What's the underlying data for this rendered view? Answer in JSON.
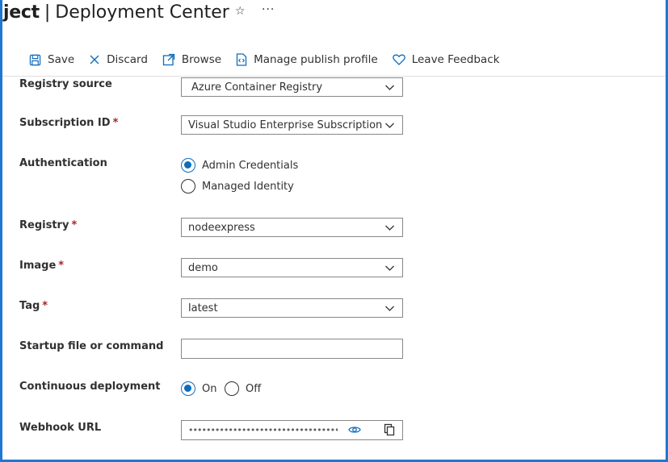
{
  "header": {
    "title_fragment": "ject",
    "separator": "|",
    "title": "Deployment Center",
    "favorite_icon": "star-icon",
    "more_icon": "ellipsis-icon",
    "more_glyph": "···",
    "star_glyph": "☆"
  },
  "toolbar": {
    "save": "Save",
    "discard": "Discard",
    "browse": "Browse",
    "manage_publish_profile": "Manage publish profile",
    "leave_feedback": "Leave Feedback"
  },
  "form": {
    "registry_source": {
      "label": "Registry source",
      "value": "Azure Container Registry"
    },
    "subscription_id": {
      "label": "Subscription ID",
      "required": "*",
      "value": "Visual Studio Enterprise Subscription"
    },
    "authentication": {
      "label": "Authentication",
      "options": [
        "Admin Credentials",
        "Managed Identity"
      ],
      "selected": "Admin Credentials"
    },
    "registry": {
      "label": "Registry",
      "required": "*",
      "value": "nodeexpress"
    },
    "image": {
      "label": "Image",
      "required": "*",
      "value": "demo"
    },
    "tag": {
      "label": "Tag",
      "required": "*",
      "value": "latest"
    },
    "startup": {
      "label": "Startup file or command",
      "value": ""
    },
    "continuous_deployment": {
      "label": "Continuous deployment",
      "options": [
        "On",
        "Off"
      ],
      "selected": "On"
    },
    "webhook_url": {
      "label": "Webhook URL",
      "masked_value": "••••••••••••••••••••••••••••••••••..."
    }
  },
  "colors": {
    "accent": "#0f6cbd",
    "border_frame": "#1e77d3",
    "required": "#a4262c"
  }
}
